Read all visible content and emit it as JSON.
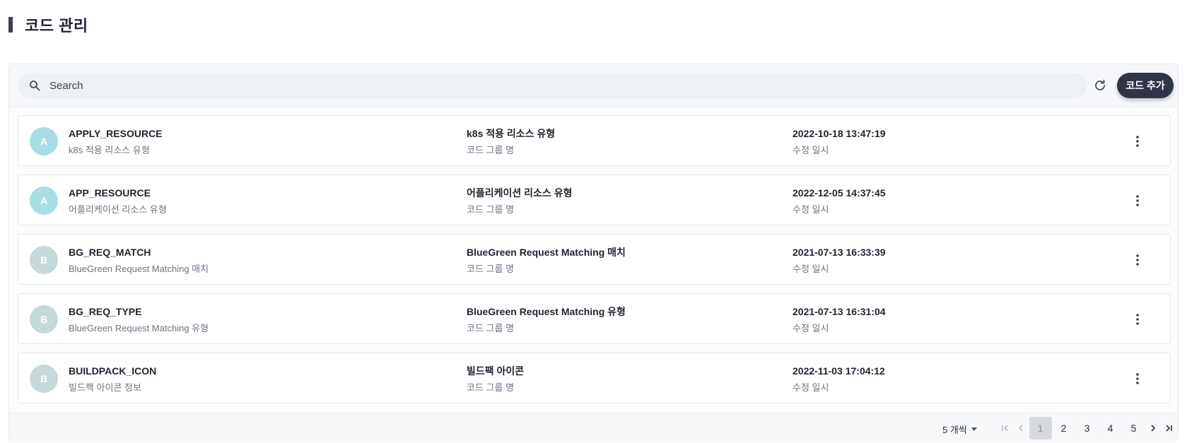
{
  "page": {
    "title": "코드 관리"
  },
  "toolbar": {
    "search_placeholder": "Search",
    "add_label": "코드 추가"
  },
  "rows": [
    {
      "avatar": "A",
      "avatar_color": "#a8dde5",
      "code": "APPLY_RESOURCE",
      "description": "k8s 적용 리소스 유형",
      "group": "k8s 적용 리소스 유형",
      "group_label": "코드 그룹 명",
      "modified": "2022-10-18 13:47:19",
      "modified_label": "수정 일시"
    },
    {
      "avatar": "A",
      "avatar_color": "#a8dde5",
      "code": "APP_RESOURCE",
      "description": "어플리케이션 리소스 유형",
      "group": "어플리케이션 리소스 유형",
      "group_label": "코드 그룹 명",
      "modified": "2022-12-05 14:37:45",
      "modified_label": "수정 일시"
    },
    {
      "avatar": "B",
      "avatar_color": "#c5d9d9",
      "code": "BG_REQ_MATCH",
      "description": "BlueGreen Request Matching 매치",
      "group": "BlueGreen Request Matching 매치",
      "group_label": "코드 그룹 명",
      "modified": "2021-07-13 16:33:39",
      "modified_label": "수정 일시"
    },
    {
      "avatar": "B",
      "avatar_color": "#c5d9d9",
      "code": "BG_REQ_TYPE",
      "description": "BlueGreen Request Matching 유형",
      "group": "BlueGreen Request Matching 유형",
      "group_label": "코드 그룹 명",
      "modified": "2021-07-13 16:31:04",
      "modified_label": "수정 일시"
    },
    {
      "avatar": "B",
      "avatar_color": "#c5d9d9",
      "code": "BUILDPACK_ICON",
      "description": "빌드팩 아이콘 정보",
      "group": "빌드팩 아이콘",
      "group_label": "코드 그룹 명",
      "modified": "2022-11-03 17:04:12",
      "modified_label": "수정 일시"
    }
  ],
  "pagination": {
    "page_size_label": "5 개씩",
    "pages": [
      "1",
      "2",
      "3",
      "4",
      "5"
    ],
    "current_page": "1"
  },
  "icons": {
    "search": "search-icon",
    "refresh": "refresh-icon",
    "more": "more-vertical-icon",
    "first": "first-page-icon",
    "prev": "chevron-left-icon",
    "next": "chevron-right-icon",
    "last": "last-page-icon"
  }
}
